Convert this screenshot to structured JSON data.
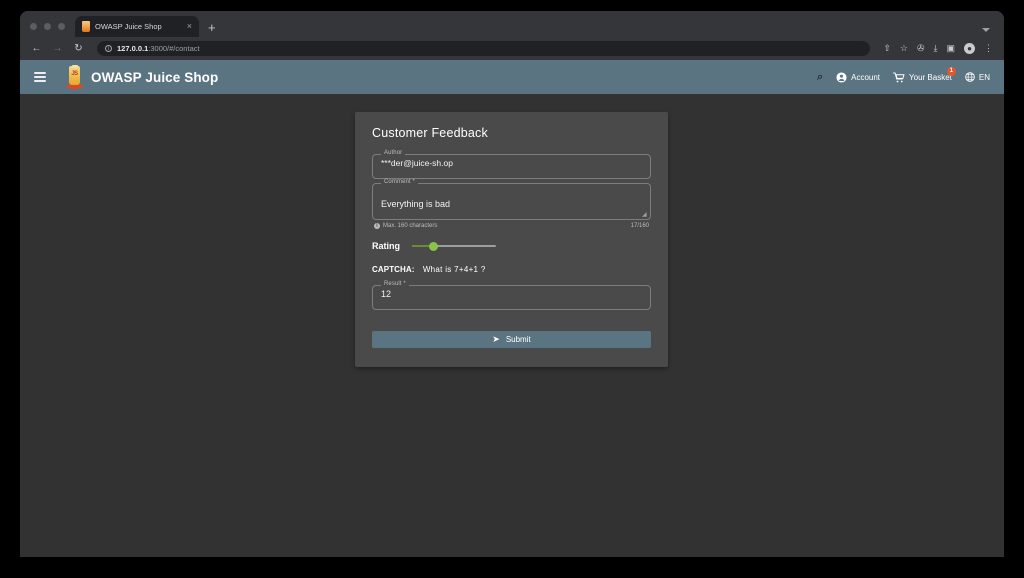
{
  "browser": {
    "tab": {
      "title": "OWASP Juice Shop",
      "favicon": "juice-bottle-icon",
      "close": "×"
    },
    "new_tab": "+",
    "nav": {
      "back": "←",
      "forward": "→",
      "reload": "↻"
    },
    "omnibox": {
      "info_glyph": "i",
      "url_host": "127.0.0.1",
      "url_rest": ":3000/#/contact"
    },
    "toolbar_icons": [
      {
        "name": "share-icon",
        "glyph": "⇧"
      },
      {
        "name": "bookmark-star-icon",
        "glyph": "☆"
      },
      {
        "name": "extensions-puzzle-icon",
        "glyph": "✇"
      },
      {
        "name": "downloads-icon",
        "glyph": "⤓"
      },
      {
        "name": "side-panel-icon",
        "glyph": "▣"
      },
      {
        "name": "profile-avatar-icon",
        "glyph": "●"
      },
      {
        "name": "browser-menu-icon",
        "glyph": "⋮"
      }
    ]
  },
  "appbar": {
    "menu_label": "menu",
    "brand": "OWASP Juice Shop",
    "logo_text": "JS",
    "search_glyph": "⌕",
    "account": {
      "label": "Account",
      "glyph": "●"
    },
    "basket": {
      "label": "Your Basket",
      "glyph": "Ὥ2",
      "badge": "1"
    },
    "language": {
      "label": "EN",
      "glyph": "⊕"
    }
  },
  "feedback": {
    "title": "Customer Feedback",
    "author": {
      "label": "Author",
      "value": "***der@juice-sh.op"
    },
    "comment": {
      "label": "Comment *",
      "value": "Everything is bad",
      "hint": "Max. 160 characters",
      "hint_icon_glyph": "i",
      "counter": "17/160"
    },
    "rating": {
      "label": "Rating",
      "value": 1,
      "min": 0,
      "max": 5
    },
    "captcha": {
      "label": "CAPTCHA:",
      "question": "What is  7+4+1 ?"
    },
    "result": {
      "label": "Result *",
      "value": "12"
    },
    "submit": {
      "label": "Submit",
      "icon_glyph": "➤"
    }
  },
  "colors": {
    "appbar": "#5b7481",
    "card": "#4a4a4a",
    "page": "#323232",
    "accent_green": "#8bc34a",
    "badge_red": "#e4572e"
  }
}
